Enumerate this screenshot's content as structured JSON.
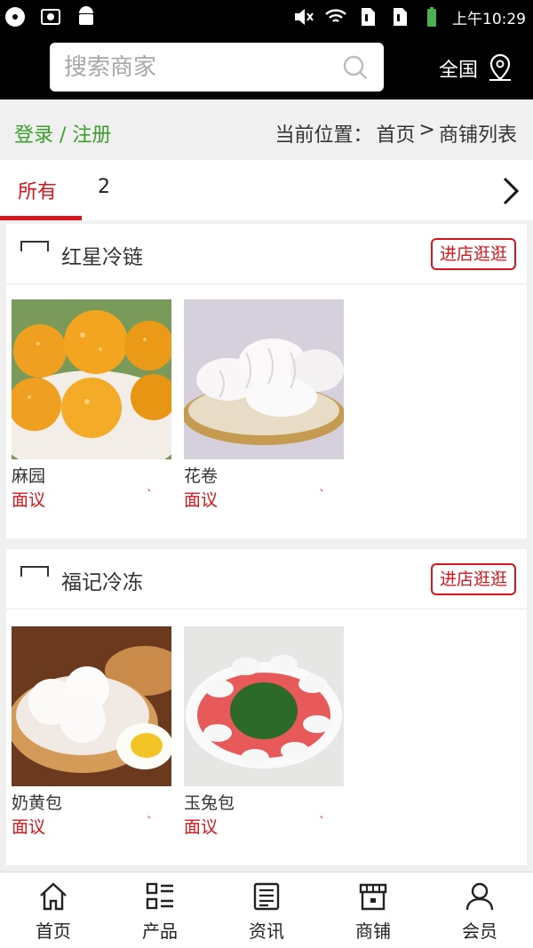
{
  "statusbar": {
    "time": "上午10:29",
    "icons": [
      "record-icon",
      "notification-icon",
      "screenshot-icon",
      "android-icon",
      "mute-icon",
      "wifi-icon",
      "sim1-icon",
      "sim2-icon",
      "battery-icon"
    ]
  },
  "search": {
    "placeholder": "搜索商家",
    "region": "全国"
  },
  "nav": {
    "login": "登录 / 注册",
    "breadcrumb_prefix": "当前位置：",
    "crumb_home": "首页",
    "crumb_sep": ">",
    "crumb_current": "商铺列表"
  },
  "tabs": {
    "all": "所有",
    "page": "2"
  },
  "shops": [
    {
      "name": "红星冷链",
      "visit": "进店逛逛",
      "products": [
        {
          "name": "麻园",
          "price": "面议",
          "mark": "`"
        },
        {
          "name": "花卷",
          "price": "面议",
          "mark": "`"
        }
      ]
    },
    {
      "name": "福记冷冻",
      "visit": "进店逛逛",
      "products": [
        {
          "name": "奶黄包",
          "price": "面议",
          "mark": "`"
        },
        {
          "name": "玉兔包",
          "price": "面议",
          "mark": "`"
        }
      ]
    }
  ],
  "bottomnav": [
    {
      "label": "首页",
      "icon": "home-icon"
    },
    {
      "label": "产品",
      "icon": "grid-list-icon"
    },
    {
      "label": "资讯",
      "icon": "news-icon"
    },
    {
      "label": "商铺",
      "icon": "store-icon"
    },
    {
      "label": "会员",
      "icon": "user-icon"
    }
  ],
  "colors": {
    "accent": "#d8151b",
    "login": "#3aa02a",
    "header": "#000000"
  }
}
